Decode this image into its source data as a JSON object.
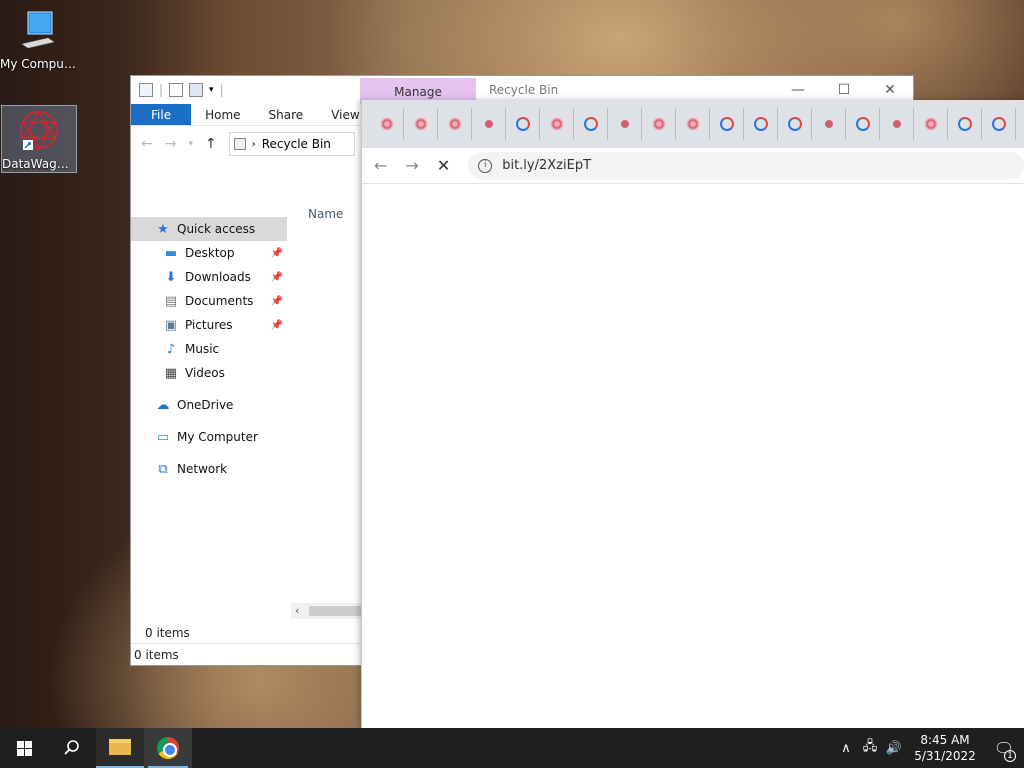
{
  "desktop": {
    "icons": [
      {
        "label": "My Computer"
      },
      {
        "label": "DataWagon..."
      }
    ]
  },
  "explorer": {
    "manage_tab": "Manage",
    "title": "Recycle Bin",
    "ribbon_tabs": [
      "File",
      "Home",
      "Share",
      "View"
    ],
    "address": "Recycle Bin",
    "nav": {
      "quick_access": "Quick access",
      "pinned": [
        {
          "label": "Desktop",
          "icon": "desktop-icon"
        },
        {
          "label": "Downloads",
          "icon": "download-icon"
        },
        {
          "label": "Documents",
          "icon": "documents-icon"
        },
        {
          "label": "Pictures",
          "icon": "pictures-icon"
        },
        {
          "label": "Music",
          "icon": "music-icon"
        },
        {
          "label": "Videos",
          "icon": "videos-icon"
        }
      ],
      "onedrive": "OneDrive",
      "my_computer": "My Computer",
      "network": "Network"
    },
    "column_name": "Name",
    "status_items": "0 items",
    "status_bar": "0 items"
  },
  "browser": {
    "url": "bit.ly/2XziEpT",
    "tab_favicons": [
      "star",
      "star",
      "star",
      "dot",
      "spin",
      "star",
      "spin",
      "dot",
      "star",
      "star",
      "spin",
      "spin",
      "spin",
      "dot",
      "spin",
      "dot",
      "star",
      "spin",
      "spin"
    ]
  },
  "taskbar": {
    "time": "8:45 AM",
    "date": "5/31/2022",
    "notification_count": "1"
  }
}
